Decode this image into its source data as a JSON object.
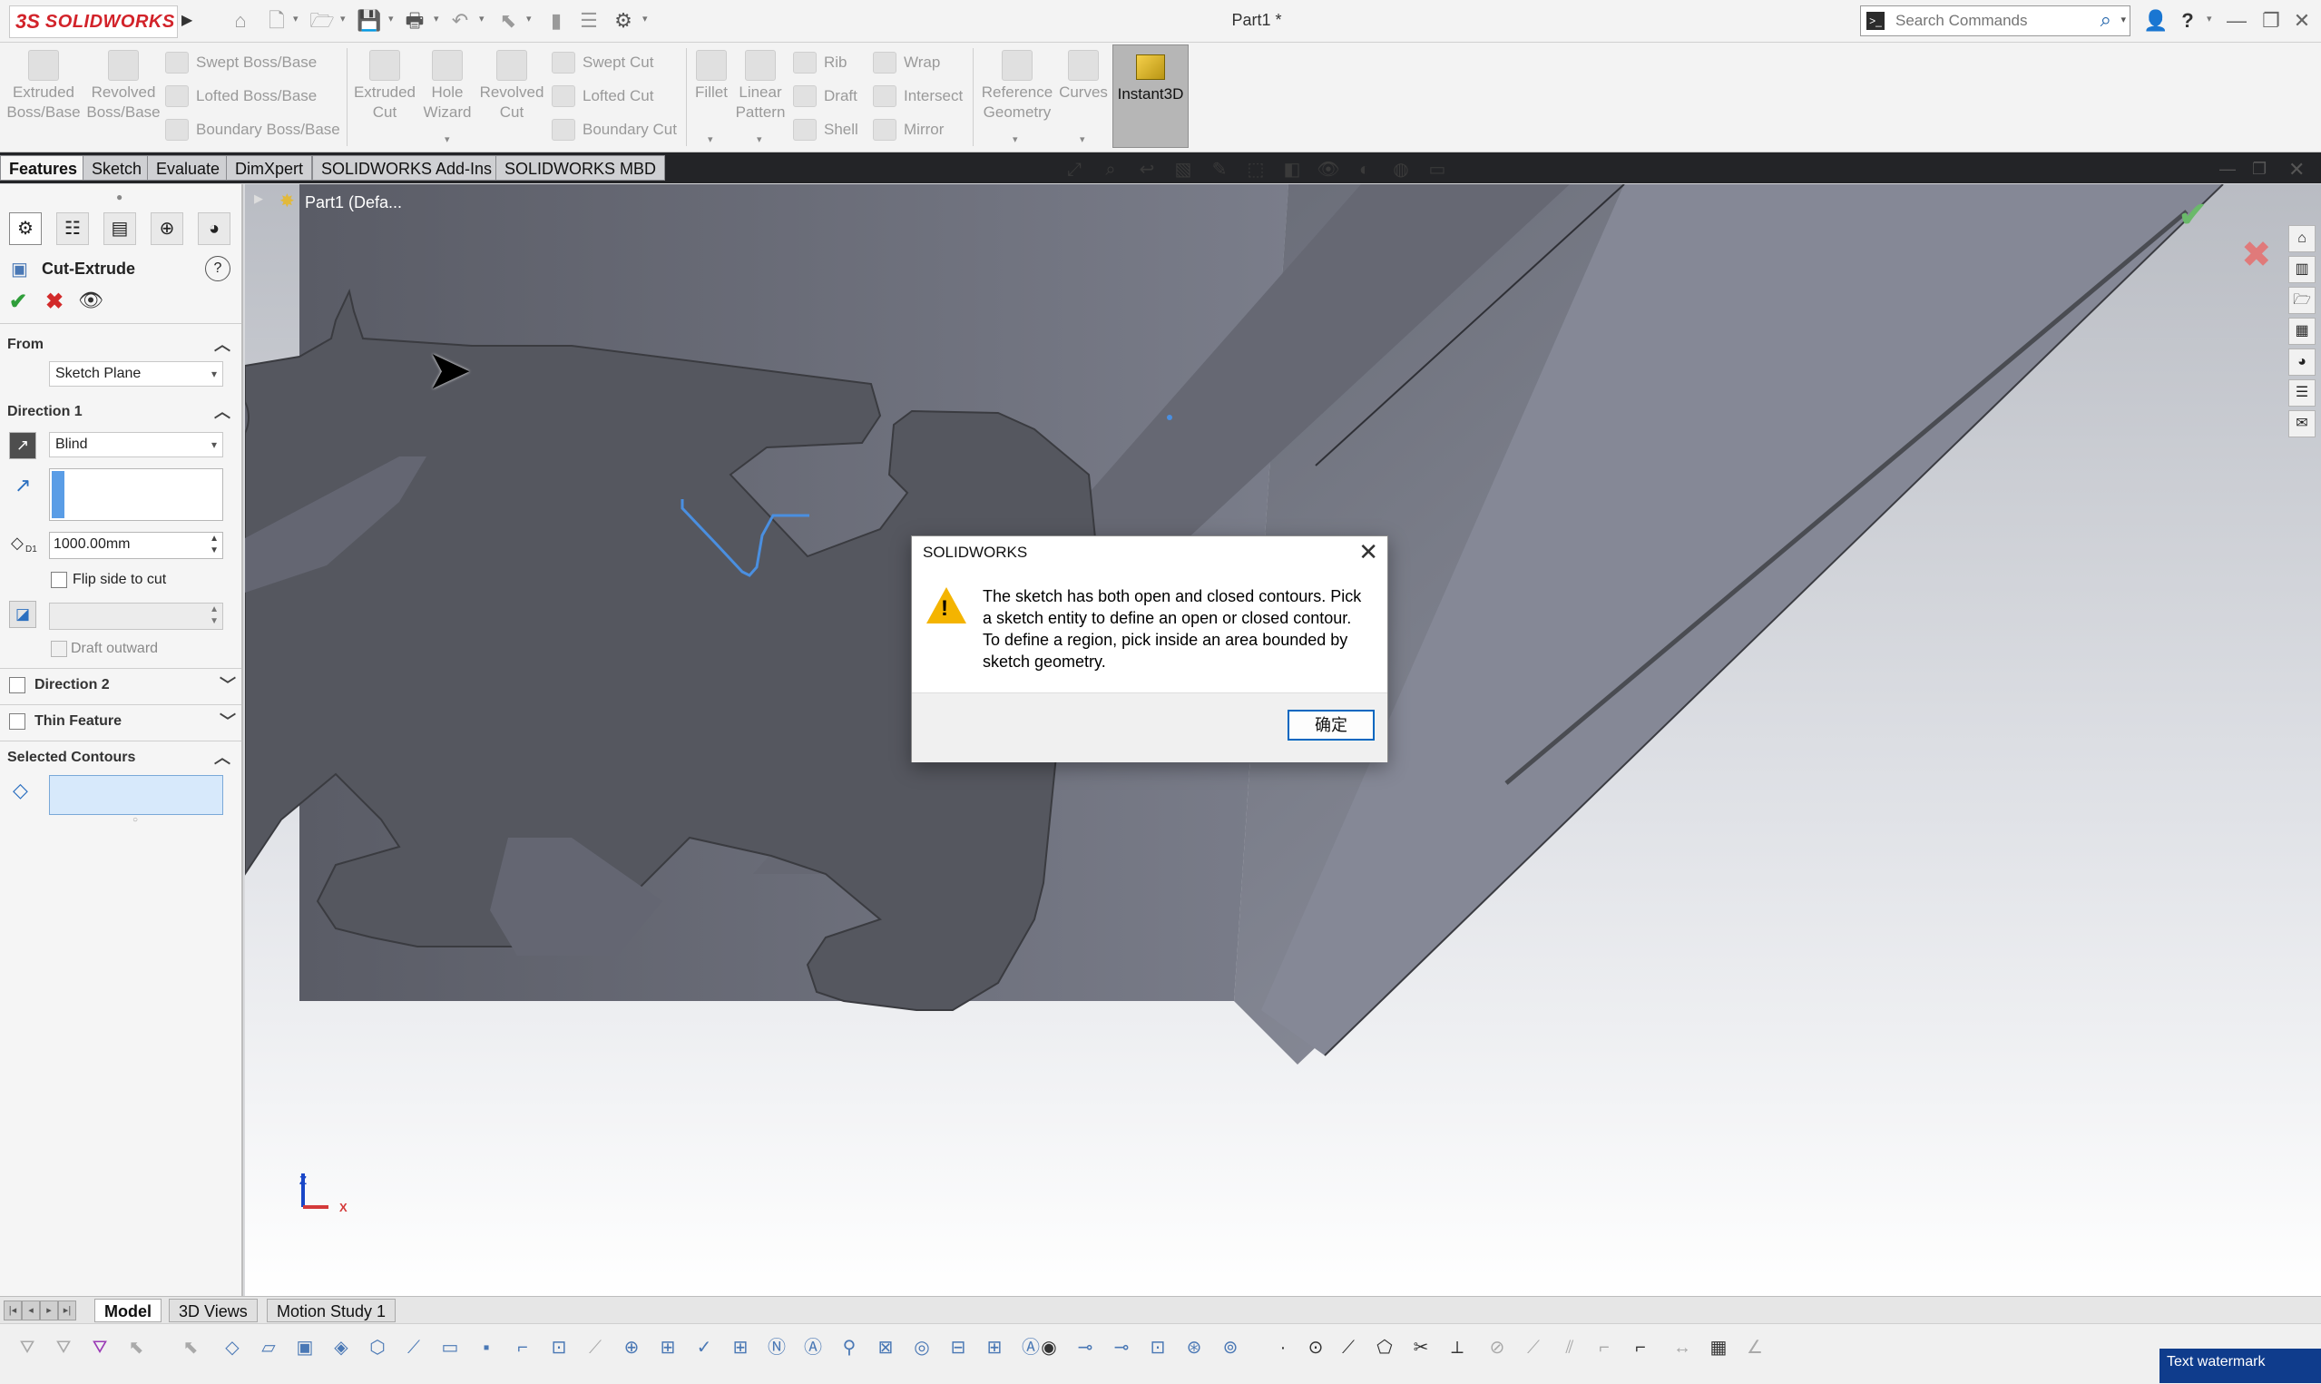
{
  "app": {
    "brand_prefix": "3S",
    "brand": "SOLIDWORKS",
    "doc_title": "Part1 *"
  },
  "search": {
    "placeholder": "Search Commands"
  },
  "ribbon": {
    "extruded_boss": "Extruded Boss/Base",
    "revolved_boss": "Revolved Boss/Base",
    "swept_boss": "Swept Boss/Base",
    "lofted_boss": "Lofted Boss/Base",
    "boundary_boss": "Boundary Boss/Base",
    "extruded_cut": "Extruded Cut",
    "hole_wizard": "Hole Wizard",
    "revolved_cut": "Revolved Cut",
    "swept_cut": "Swept Cut",
    "lofted_cut": "Lofted Cut",
    "boundary_cut": "Boundary Cut",
    "fillet": "Fillet",
    "linear_pattern": "Linear Pattern",
    "rib": "Rib",
    "draft": "Draft",
    "shell": "Shell",
    "wrap": "Wrap",
    "intersect": "Intersect",
    "mirror": "Mirror",
    "reference_geometry": "Reference Geometry",
    "curves": "Curves",
    "instant3d": "Instant3D"
  },
  "tabs": [
    "Features",
    "Sketch",
    "Evaluate",
    "DimXpert",
    "SOLIDWORKS Add-Ins",
    "SOLIDWORKS MBD"
  ],
  "tree": {
    "root": "Part1  (Defa..."
  },
  "property_manager": {
    "title": "Cut-Extrude",
    "help": "?",
    "from_label": "From",
    "from_value": "Sketch Plane",
    "direction1_label": "Direction 1",
    "end_condition": "Blind",
    "depth": "1000.00mm",
    "flip_side": "Flip side to cut",
    "draft_outward": "Draft outward",
    "direction2_label": "Direction 2",
    "thin_feature_label": "Thin Feature",
    "selected_contours_label": "Selected Contours",
    "depth_prefix": "D1"
  },
  "dialog": {
    "title": "SOLIDWORKS",
    "message": "The sketch has both open and closed contours. Pick a sketch entity to define an open or closed contour. To define a region, pick inside an area bounded by sketch geometry.",
    "ok": "确定"
  },
  "triad": {
    "z": "Z",
    "x": "X"
  },
  "bottom_tabs": [
    "Model",
    "3D Views",
    "Motion Study 1"
  ],
  "watermark": "Text watermark",
  "colors": {
    "accent": "#0067c0",
    "brand_red": "#d2232a",
    "part": "#55575f",
    "sketch": "#4a8fe0",
    "warning": "#f4b400",
    "accept": "#2f9e3a",
    "cancel": "#d22a2a"
  }
}
